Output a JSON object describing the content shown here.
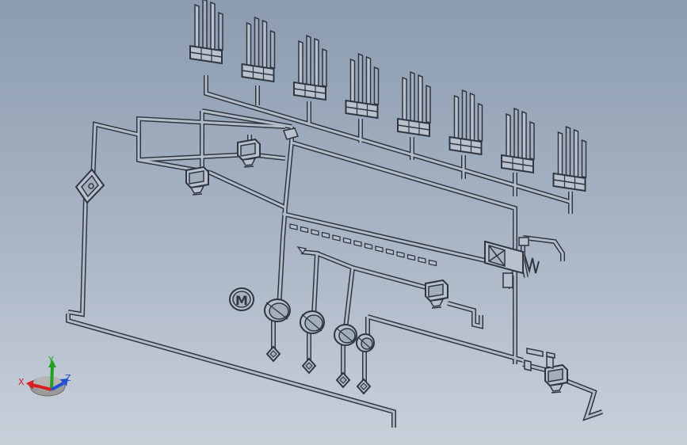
{
  "scene": {
    "description": "",
    "colors": {
      "background_top": "#8c9bb0",
      "background_bottom": "#c9d0da",
      "edge": "#2f3640",
      "face_light": "#c4cbd6",
      "face_mid": "#a9b3c1",
      "face_dark": "#8d98a8"
    }
  },
  "triad": {
    "labels": {
      "x": "X",
      "y": "Y",
      "z": "Z"
    },
    "colors": {
      "x": "#d42020",
      "y": "#22a022",
      "z": "#2050d0",
      "base": "#9a9a9a"
    }
  },
  "components": {
    "valve_manifolds": 8,
    "solenoid_valves": 5,
    "pumps": 4,
    "motor_symbol": "M",
    "check_valves": 4,
    "filter_units": 1
  }
}
